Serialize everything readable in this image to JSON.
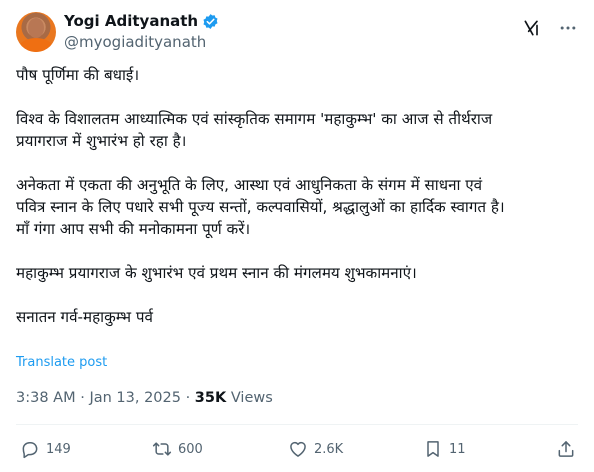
{
  "author": {
    "display_name": "Yogi Adityanath",
    "handle": "@myogiadityanath",
    "verified_color": "#1d9bf0",
    "avatar_icon": "avatar-photo"
  },
  "post": {
    "paragraphs": [
      [
        "पौष पूर्णिमा की बधाई।"
      ],
      [
        "विश्व के विशालतम आध्यात्मिक एवं सांस्कृतिक समागम 'महाकुम्भ' का आज से तीर्थराज",
        "प्रयागराज में शुभारंभ हो रहा है।"
      ],
      [
        "अनेकता में एकता की अनुभूति के लिए, आस्था एवं आधुनिकता के संगम में साधना एवं",
        "पवित्र स्नान के लिए पधारे सभी पूज्य सन्तों, कल्पवासियों, श्रद्धालुओं का हार्दिक स्वागत है।",
        "माँ गंगा आप सभी की मनोकामना पूर्ण करें।"
      ],
      [
        "महाकुम्भ प्रयागराज के शुभारंभ एवं प्रथम स्नान की मंगलमय शुभकामनाएं।"
      ],
      [
        "सनातन गर्व-महाकुम्भ पर्व"
      ]
    ],
    "translate_label": "Translate post",
    "time": "3:38 AM",
    "date": "Jan 13, 2025",
    "separator": "·",
    "views_count": "35K",
    "views_label": "Views"
  },
  "actions": {
    "replies": "149",
    "reposts": "600",
    "likes": "2.6K",
    "bookmarks": "11"
  },
  "icons": [
    "grok-icon",
    "more-icon",
    "reply-icon",
    "repost-icon",
    "like-icon",
    "bookmark-icon",
    "share-icon",
    "verified-badge-icon"
  ]
}
